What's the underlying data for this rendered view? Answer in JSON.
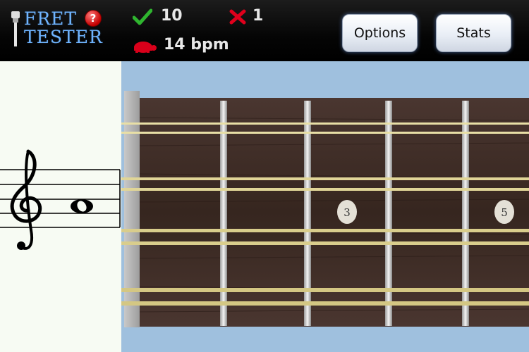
{
  "header": {
    "logo_line1": "Fret",
    "logo_line2": "Tester",
    "help_icon": "?",
    "correct_count": "10",
    "wrong_count": "1",
    "tempo": "14 bpm"
  },
  "buttons": {
    "options_label": "Options",
    "stats_label": "Stats"
  },
  "fretboard": {
    "inlay_labels": [
      "3",
      "5"
    ]
  },
  "icons": {
    "check": "check-icon",
    "wrong": "x-icon",
    "tempo": "turtle-icon",
    "help": "help-icon",
    "clef": "treble-clef-icon"
  },
  "colors": {
    "logo": "#6fb4ff",
    "check": "#2fb52f",
    "wrong": "#e0001c",
    "turtle": "#d9001a",
    "fretboard": "#3b2a24",
    "string": "#e8dfa6",
    "background": "#9fc0de"
  }
}
